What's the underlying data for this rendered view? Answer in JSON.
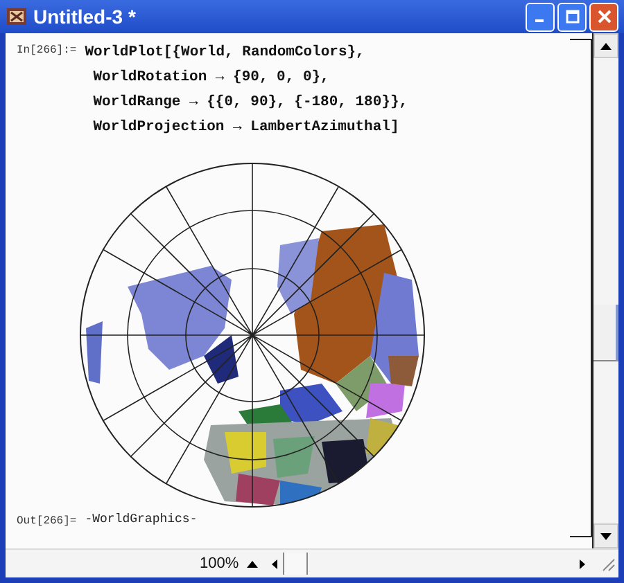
{
  "window": {
    "title": "Untitled-3 *"
  },
  "input": {
    "label": "In[266]:=",
    "lines": [
      "WorldPlot[{World, RandomColors},",
      "WorldRotation → {90, 0, 0},",
      "WorldRange → {{0, 90}, {-180, 180}},",
      "WorldProjection → LambertAzimuthal]"
    ]
  },
  "output": {
    "label": "Out[266]=",
    "value": "-WorldGraphics-"
  },
  "status_bar": {
    "zoom": "100%"
  }
}
